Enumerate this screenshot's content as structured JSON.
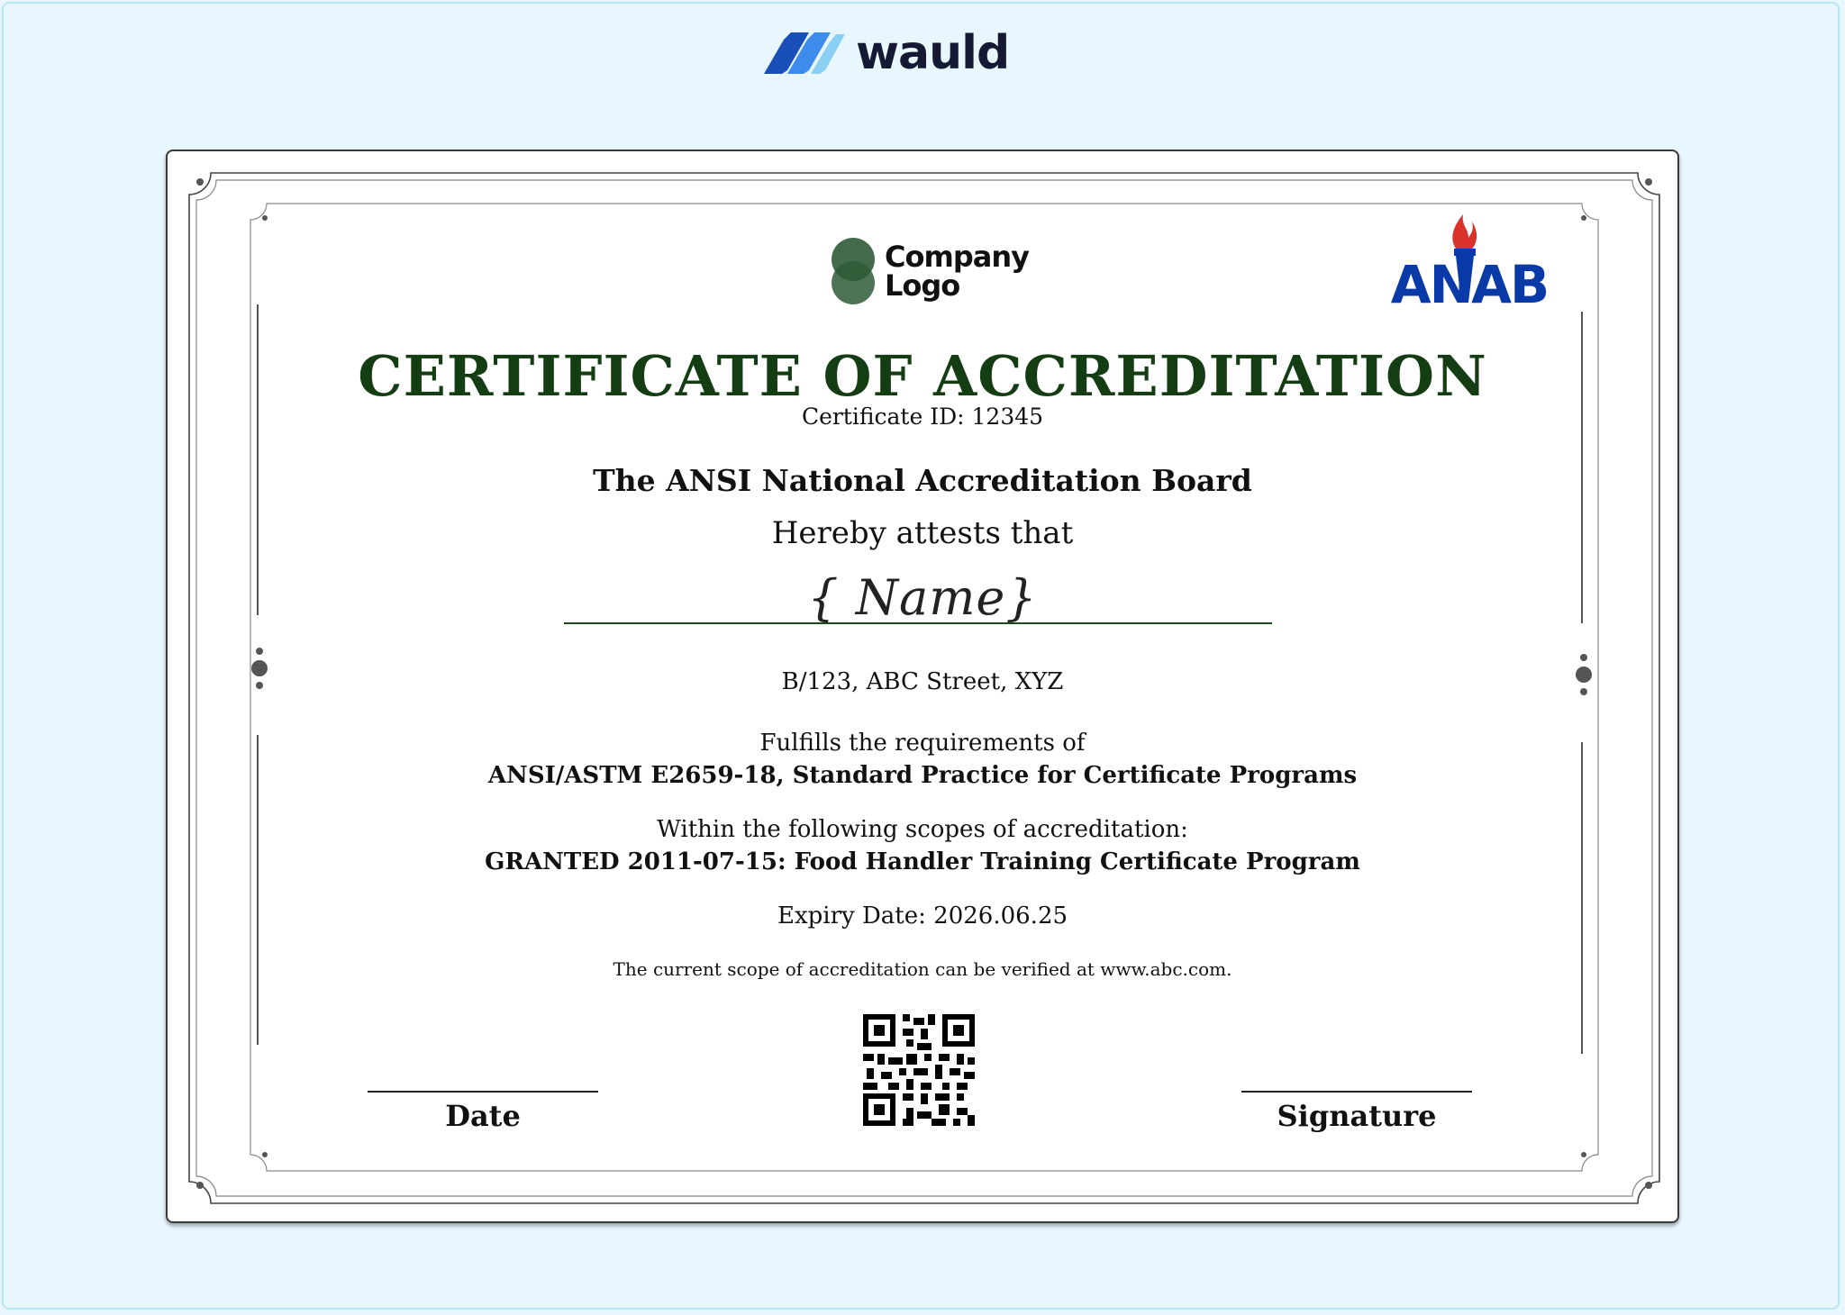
{
  "brand": {
    "name": "wauld",
    "icon": "wauld-logo-icon"
  },
  "certificate": {
    "company_logo": {
      "line1": "Company",
      "line2": "Logo",
      "icon": "company-logo-icon"
    },
    "accreditor_logo": {
      "text": "ANAB",
      "icon": "torch-icon"
    },
    "title": "CERTIFICATE OF ACCREDITATION",
    "certificate_id": "Certificate ID: 12345",
    "issuer": "The ANSI National Accreditation Board",
    "attests": "Hereby attests that",
    "recipient_placeholder": "{ Name}",
    "address": "B/123, ABC Street, XYZ",
    "fulfills_intro": "Fulfills the requirements of",
    "standard": "ANSI/ASTM E2659-18, Standard Practice for Certificate Programs",
    "scopes_intro": "Within the following scopes of accreditation:",
    "scope": "GRANTED 2011-07-15: Food Handler Training Certificate Program",
    "expiry": "Expiry Date: 2026.06.25",
    "verify_note": "The current scope of accreditation can be verified at www.abc.com.",
    "qr_icon": "qr-code-icon",
    "date_label": "Date",
    "signature_label": "Signature"
  },
  "colors": {
    "page_background": "#e8f6fd",
    "title_green": "#143d14",
    "brand_dark": "#141a33",
    "brand_blue": "#2a6fd6",
    "anab_blue": "#0a3aa8",
    "anab_flame": "#d8322a"
  }
}
